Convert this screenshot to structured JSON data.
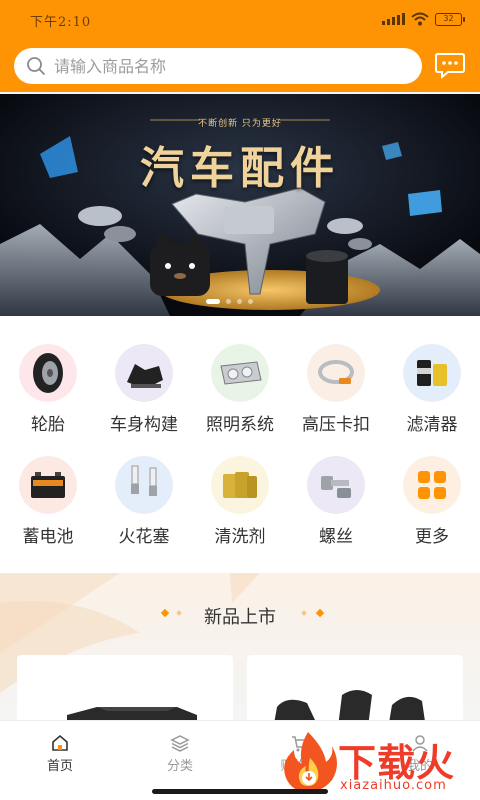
{
  "status_bar": {
    "time": "下午2:10",
    "battery": "32"
  },
  "header": {
    "search": {
      "placeholder": "请输入商品名称",
      "value": ""
    },
    "message_icon": "chat-bubble-icon",
    "accent_color": "#fe9304"
  },
  "banner": {
    "subtitle": "不断创新 只为更好",
    "title": "汽车配件",
    "slide_count": 4,
    "active_slide": 1
  },
  "categories": [
    {
      "label": "轮胎",
      "icon": "tire-icon"
    },
    {
      "label": "车身构建",
      "icon": "car-body-icon"
    },
    {
      "label": "照明系统",
      "icon": "headlight-icon"
    },
    {
      "label": "高压卡扣",
      "icon": "hose-clamp-icon"
    },
    {
      "label": "滤清器",
      "icon": "filter-icon"
    },
    {
      "label": "蓄电池",
      "icon": "battery-icon"
    },
    {
      "label": "火花塞",
      "icon": "spark-plug-icon"
    },
    {
      "label": "清洗剂",
      "icon": "cleaner-icon"
    },
    {
      "label": "螺丝",
      "icon": "screw-icon"
    },
    {
      "label": "更多",
      "icon": "more-grid-icon"
    }
  ],
  "new_products": {
    "title": "新品上市"
  },
  "tabbar": {
    "tabs": [
      {
        "label": "首页",
        "icon": "home-icon",
        "active": true
      },
      {
        "label": "分类",
        "icon": "layers-icon",
        "active": false
      },
      {
        "label": "购物车",
        "icon": "cart-icon",
        "active": false
      },
      {
        "label": "我的",
        "icon": "user-icon",
        "active": false
      }
    ]
  },
  "watermark": {
    "brand": "下载火",
    "domain": "xiazaihuo.com"
  }
}
